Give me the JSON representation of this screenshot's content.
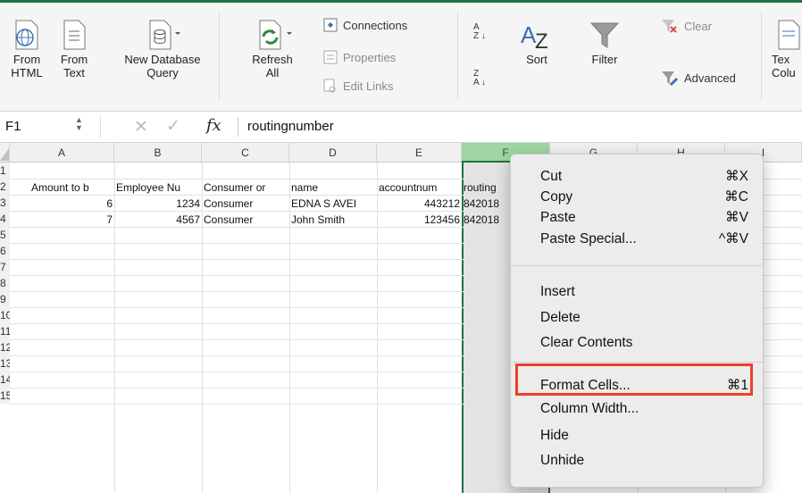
{
  "ribbon": {
    "from_html": "From\nHTML",
    "from_html_l1": "From",
    "from_html_l2": "HTML",
    "from_text_l1": "From",
    "from_text_l2": "Text",
    "new_db_l1": "New Database",
    "new_db_l2": "Query",
    "refresh_l1": "Refresh",
    "refresh_l2": "All",
    "connections": "Connections",
    "properties": "Properties",
    "edit_links": "Edit Links",
    "sort": "Sort",
    "filter": "Filter",
    "clear": "Clear",
    "advanced": "Advanced",
    "text_cols_l1": "Tex",
    "text_cols_l2": "Colu",
    "accent_color": "#1f7244"
  },
  "formula_bar": {
    "name_box": "F1",
    "fx": "fx",
    "value": "routingnumber"
  },
  "columns": [
    "A",
    "B",
    "C",
    "D",
    "E",
    "F",
    "G",
    "H",
    "I"
  ],
  "rows": [
    "1",
    "2",
    "3",
    "4",
    "5",
    "6",
    "7",
    "8",
    "9",
    "10",
    "11",
    "12",
    "13",
    "14",
    "15"
  ],
  "cells": {
    "r1": [
      "Amount to b",
      "Employee Nu",
      "Consumer or",
      "name",
      "accountnum",
      "routing"
    ],
    "r2": [
      "6",
      "1234",
      "Consumer",
      "EDNA S AVEI",
      "443212",
      "842018"
    ],
    "r3": [
      "7",
      "4567",
      "Consumer",
      "John Smith",
      "123456",
      "842018"
    ]
  },
  "context_menu": {
    "cut": "Cut",
    "cut_sc": "⌘X",
    "copy": "Copy",
    "copy_sc": "⌘C",
    "paste": "Paste",
    "paste_sc": "⌘V",
    "paste_special": "Paste Special...",
    "paste_special_sc": "^⌘V",
    "insert": "Insert",
    "delete": "Delete",
    "clear_contents": "Clear Contents",
    "format_cells": "Format Cells...",
    "format_cells_sc": "⌘1",
    "column_width": "Column Width...",
    "hide": "Hide",
    "unhide": "Unhide",
    "highlight_color": "#e8412c"
  }
}
